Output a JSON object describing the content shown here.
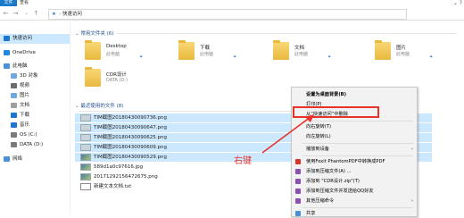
{
  "ribbon": {
    "file_tab": "文件",
    "view_tab": "查看",
    "win_controls": "⌄ ?"
  },
  "address": {
    "path": "快速访问"
  },
  "sidebar": {
    "items": [
      {
        "label": "快速访问",
        "color": "#1d75d0"
      },
      {
        "label": "OneDrive",
        "color": "#1e88e5"
      },
      {
        "label": "此电脑",
        "color": "#4a90d9"
      },
      {
        "label": "3D 对象",
        "color": "#6fa8dc"
      },
      {
        "label": "视频",
        "color": "#6c6c6c"
      },
      {
        "label": "图片",
        "color": "#6fa8dc"
      },
      {
        "label": "文档",
        "color": "#9e9e9e"
      },
      {
        "label": "下载",
        "color": "#1d75d0"
      },
      {
        "label": "音乐",
        "color": "#1d75d0"
      },
      {
        "label": "OS (C:)",
        "color": "#7a7a7a"
      },
      {
        "label": "DATA (D:)",
        "color": "#7a7a7a"
      },
      {
        "label": "网络",
        "color": "#4a90d9"
      }
    ]
  },
  "frequent": {
    "header": "常用文件夹 (6)",
    "tiles": [
      {
        "name": "Desktop",
        "sub": "此电脑"
      },
      {
        "name": "下载",
        "sub": "此电脑"
      },
      {
        "name": "文档",
        "sub": "此电脑"
      },
      {
        "name": "图片",
        "sub": "此电脑"
      },
      {
        "name": "CDR设计",
        "sub": "DATA (D:)"
      }
    ]
  },
  "recent": {
    "header": "最近使用的文件 (8)",
    "files": [
      {
        "name": "TIM截图20180430090736.png",
        "kind": "img",
        "selected": true
      },
      {
        "name": "TIM截图20180430090647.png",
        "kind": "img",
        "selected": true
      },
      {
        "name": "TIM截图20180430090625.png",
        "kind": "img",
        "selected": true
      },
      {
        "name": "TIM截图20180430090609.png",
        "kind": "img",
        "selected": true
      },
      {
        "name": "TIM截图20180430090529.png",
        "kind": "photo",
        "selected": true
      },
      {
        "name": "589d1a0c97616.jpg",
        "kind": "photo",
        "selected": false
      },
      {
        "name": "20171292156472675.png",
        "kind": "photo",
        "selected": false
      },
      {
        "name": "新建文本文档.txt",
        "kind": "txt",
        "selected": false
      }
    ]
  },
  "context_menu": {
    "items": [
      {
        "label": "设置为桌面背景(B)",
        "bold": true
      },
      {
        "label": "打印(P)"
      },
      {
        "label": "从“快速访问”中删除"
      },
      {
        "sep": true
      },
      {
        "label": "向右旋转(T)"
      },
      {
        "label": "向左旋转(L)"
      },
      {
        "sep": true
      },
      {
        "label": "播放到设备",
        "submenu": true
      },
      {
        "sep": true
      },
      {
        "label": "使用Foxit PhantomPDF中转换成PDF",
        "icon": "#d9342b"
      },
      {
        "label": "添加到压缩文件(A) ...",
        "icon": "#8a4fb0"
      },
      {
        "label": "添加到 \"CDR设计.zip\"(T)",
        "icon": "#8a4fb0"
      },
      {
        "label": "添加到压缩文件并发送给QQ好友",
        "icon": "#8a4fb0"
      },
      {
        "label": "其他压缩命令",
        "icon": "#8a4fb0",
        "submenu": true
      },
      {
        "sep": true
      },
      {
        "label": "共享",
        "icon": "#4a90d9"
      }
    ]
  },
  "annotation": {
    "label": "右键",
    "color": "#e8322a"
  }
}
